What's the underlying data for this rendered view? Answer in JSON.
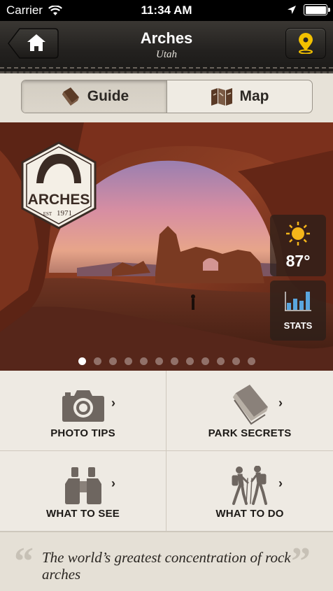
{
  "status_bar": {
    "carrier": "Carrier",
    "time": "11:34 AM"
  },
  "nav": {
    "title": "Arches",
    "subtitle": "Utah",
    "back_icon": "home-icon",
    "location_icon": "location-pin-icon"
  },
  "segments": [
    {
      "label": "Guide",
      "icon": "book-icon",
      "active": true
    },
    {
      "label": "Map",
      "icon": "map-icon",
      "active": false
    }
  ],
  "hero": {
    "badge_name": "ARCHES",
    "badge_year": "1971",
    "badge_est": "EST",
    "weather_temp": "87°",
    "weather_icon": "sun-icon",
    "stats_label": "STATS",
    "page_count": 12,
    "active_page": 1
  },
  "tiles": [
    {
      "label": "PHOTO TIPS",
      "icon": "camera-icon"
    },
    {
      "label": "PARK SECRETS",
      "icon": "open-book-icon"
    },
    {
      "label": "WHAT TO SEE",
      "icon": "binoculars-icon"
    },
    {
      "label": "WHAT TO DO",
      "icon": "hikers-icon"
    }
  ],
  "quote": {
    "text": "The world’s greatest concentration of rock arches"
  },
  "colors": {
    "nav_bg": "#23211f",
    "pin_yellow": "#f2c100",
    "tile_icon": "#6e6660",
    "sky_pink": "#d98fa3"
  }
}
